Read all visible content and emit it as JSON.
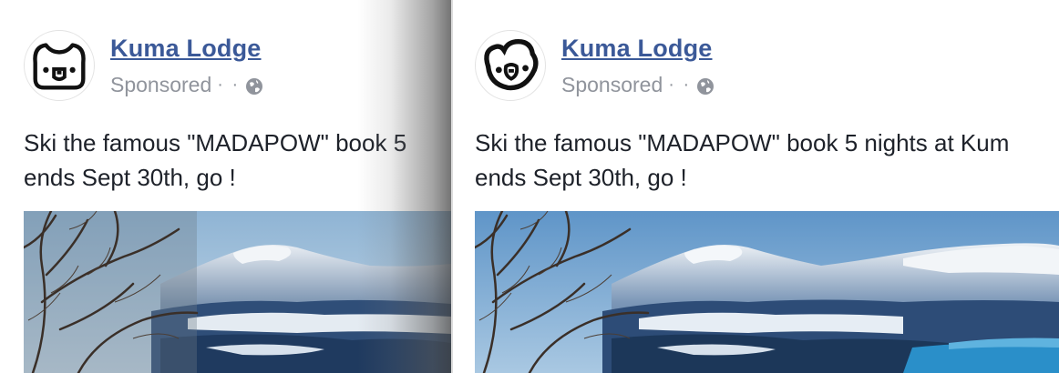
{
  "left_ad": {
    "page_name": "Kuma Lodge",
    "sponsored_label": "Sponsored",
    "dots": "· ·",
    "text_line1": "Ski the famous \"MADAPOW\" book 5",
    "text_line2": "ends Sept 30th, go !"
  },
  "right_ad": {
    "page_name": "Kuma Lodge",
    "sponsored_label": "Sponsored",
    "dots": "· ·",
    "text_line1": "Ski the famous \"MADAPOW\" book 5 nights at Kum",
    "text_line2": "ends Sept 30th, go !"
  },
  "icons": {
    "left_avatar": "bear-logo-icon",
    "right_avatar": "bear-logo-icon",
    "privacy": "globe-icon"
  },
  "colors": {
    "link": "#3b5998",
    "meta": "#90949c",
    "text": "#1d2129"
  }
}
